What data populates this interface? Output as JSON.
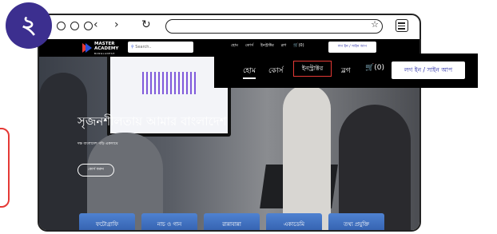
{
  "step_badge": "২",
  "browser": {
    "nav_arrows": "‹ ›",
    "reload_icon": "↻",
    "star_icon": "☆"
  },
  "site": {
    "logo_main": "MASTER",
    "logo_second": "ACADEMY",
    "logo_sub": "BANGLADESH",
    "search_placeholder": "Search..",
    "mini_nav": [
      "হোম",
      "কোর্স",
      "ইনস্ট্রাক্টর",
      "ব্লগ",
      "(0)"
    ],
    "mini_login": "লগ ইন / সাইন আপ"
  },
  "hero": {
    "title": "সৃজনশীলতায় আমার বাংলাদেশ",
    "subtitle": "দক্ষ বাংলাদেশ গড়ি একসাথে",
    "cta": "কোর্স করুন",
    "categories": [
      "ফটোগ্রাফি",
      "নাচ ও গান",
      "রান্নাবান্না",
      "একাডেমি",
      "তথ্য প্রযুক্তি"
    ]
  },
  "callout": {
    "home": "হোম",
    "course": "কোর্স",
    "instructor": "ইনস্ট্রাক্টর",
    "blog": "ব্লগ",
    "cart_count": "(0)",
    "login": "লগ ইন / সাইন আপ"
  },
  "colors": {
    "badge": "#3c2f8f",
    "highlight": "#e53935",
    "accent_blue": "#3a63e6"
  }
}
